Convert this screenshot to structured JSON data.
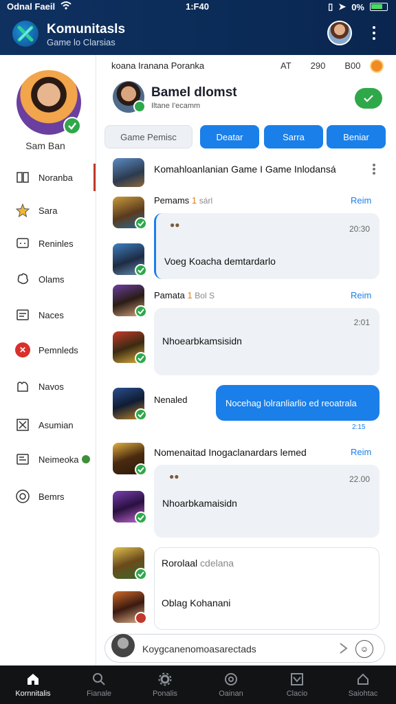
{
  "status": {
    "carrier": "Odnal Faeil",
    "time": "1:F40",
    "battery": "0%"
  },
  "header": {
    "title": "Komunitasls",
    "subtitle": "Game lo Clarsias"
  },
  "sidebar": {
    "user_name": "Sam Ban",
    "items": [
      {
        "label": "Noranba",
        "icon": "book-icon"
      },
      {
        "label": "Sara",
        "icon": "star-icon"
      },
      {
        "label": "Reninles",
        "icon": "chat-icon"
      },
      {
        "label": "Olams",
        "icon": "puzzle-icon"
      },
      {
        "label": "Naces",
        "icon": "document-icon"
      },
      {
        "label": "Pemnleds",
        "icon": "x-circle-icon"
      },
      {
        "label": "Navos",
        "icon": "people-icon"
      },
      {
        "label": "Asumian",
        "icon": "square-x-icon"
      },
      {
        "label": "Neimeoka",
        "icon": "card-icon"
      },
      {
        "label": "Bemrs",
        "icon": "target-icon"
      }
    ]
  },
  "main": {
    "breadcrumb": "koana Iranana Poranka",
    "stats": [
      "AT",
      "290",
      "B00"
    ],
    "profile": {
      "name": "Bamel dlomst",
      "subtitle": "Iltane I'ecamm"
    },
    "filters": {
      "search_placeholder": "Game  Pemisc",
      "buttons": [
        "Deatar",
        "Sarra",
        "Beniar"
      ]
    },
    "thread_title": "Komahloanlanian Game I Game Inlodansá",
    "posts": [
      {
        "name": "Pemams",
        "num": "1",
        "meta": "sárl",
        "reply": "Reim",
        "time": "20:30",
        "text": "Voeg Koacha demtardarlo"
      },
      {
        "name": "Pamata",
        "num": "1",
        "meta": "Bol S",
        "reply": "Reim",
        "time": "2:01",
        "text": "Nhoearbkamsisidn"
      },
      {
        "name": "Nenaled",
        "bubble": "Nocehag lolranliarlio ed reoatrala",
        "time": "2:15"
      },
      {
        "name": "Nomenaitad Inogaclanardars lemed",
        "reply": "Reim",
        "time": "22.00",
        "text": "Nhoarbkamaisidn"
      }
    ],
    "card": {
      "title": "Rorolaal",
      "title_muted": "cdelana",
      "text": "Oblag Kohanani"
    },
    "composer": {
      "value": "Koygcanenomoasarectads"
    }
  },
  "bottom_nav": [
    {
      "label": "Kornnitalis",
      "icon": "home-icon",
      "active": true
    },
    {
      "label": "Fianale",
      "icon": "search-icon",
      "active": false
    },
    {
      "label": "Ponalis",
      "icon": "gear-icon",
      "active": false
    },
    {
      "label": "Oainan",
      "icon": "badge-icon",
      "active": false
    },
    {
      "label": "Clacio",
      "icon": "check-box-icon",
      "active": false
    },
    {
      "label": "Saiohtac",
      "icon": "bell-icon",
      "active": false
    }
  ],
  "colors": {
    "header": "#0f3160",
    "accent": "#1a7fe8",
    "success": "#2ea84a",
    "danger": "#d9302c"
  }
}
